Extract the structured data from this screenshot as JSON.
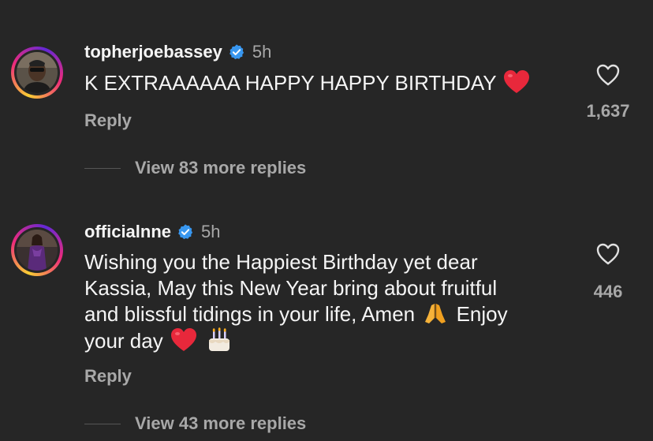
{
  "comments": [
    {
      "username": "topherjoebassey",
      "time": "5h",
      "text": "K EXTRAAAAAA HAPPY HAPPY BIRTHDAY",
      "reply_label": "Reply",
      "likes": "1,637",
      "view_replies": "View 83 more replies",
      "emojis": [
        "red-heart"
      ]
    },
    {
      "username": "officialnne",
      "time": "5h",
      "text_line1": "Wishing you the Happiest Birthday yet dear",
      "text_line2": "Kassia, May this New Year bring about fruitful",
      "text_line3a": "and blissful tidings in your life, Amen",
      "text_line3b": "Enjoy",
      "text_line4": "your day",
      "reply_label": "Reply",
      "likes": "446",
      "view_replies": "View 43 more replies",
      "emojis": [
        "folded-hands",
        "red-heart",
        "birthday-cake"
      ]
    }
  ],
  "colors": {
    "background": "#262626",
    "primary_text": "#f5f5f5",
    "secondary_text": "#a8a8a8",
    "verified": "#3897f0",
    "heart_emoji": "#e8283b"
  }
}
